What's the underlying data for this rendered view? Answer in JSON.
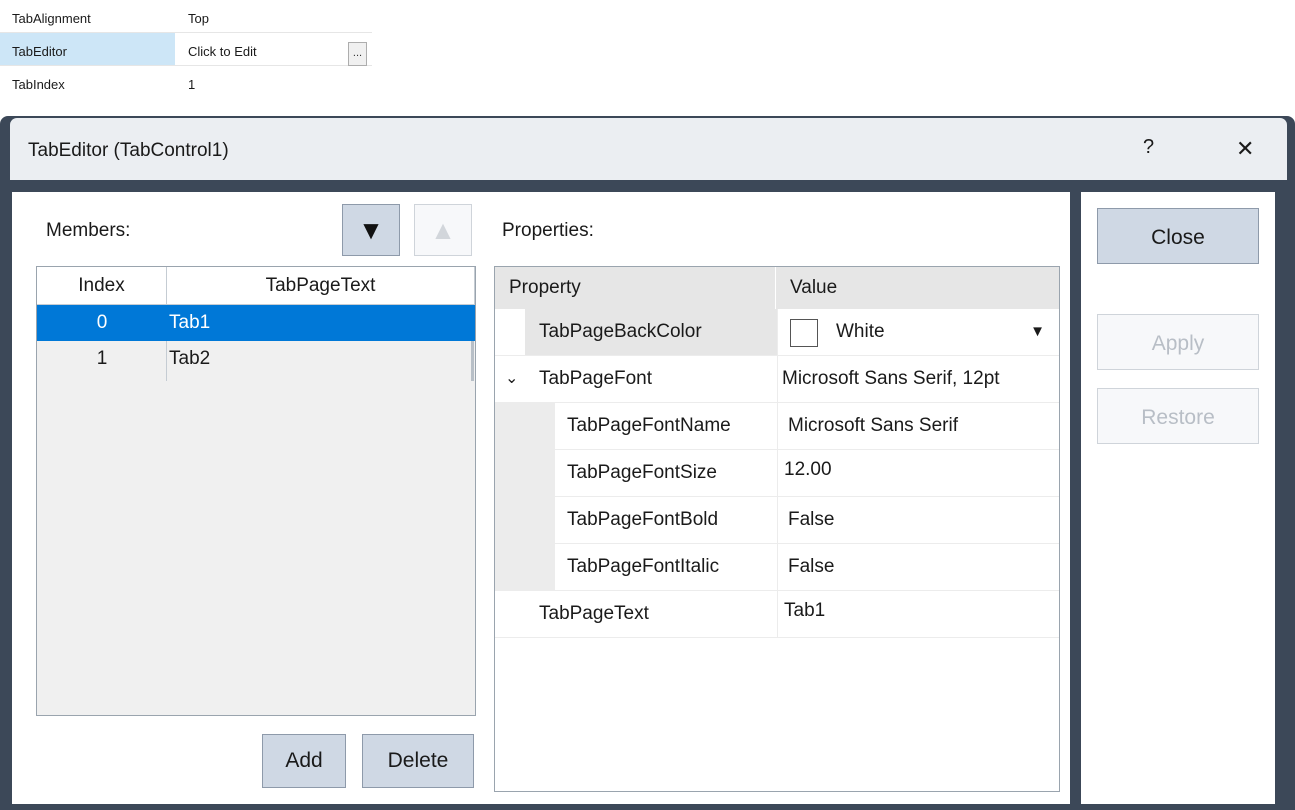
{
  "top_grid": {
    "rows": [
      {
        "name": "TabAlignment",
        "value": "Top"
      },
      {
        "name": "TabEditor",
        "value": "Click to Edit"
      },
      {
        "name": "TabIndex",
        "value": "1"
      }
    ],
    "ellipsis_label": "..."
  },
  "dialog": {
    "title": "TabEditor (TabControl1)",
    "help_label": "?",
    "close_glyph": "✕"
  },
  "members": {
    "label": "Members:",
    "move_down_glyph": "▼",
    "move_up_glyph": "▲",
    "columns": [
      "Index",
      "TabPageText"
    ],
    "rows": [
      {
        "index": "0",
        "text": "Tab1"
      },
      {
        "index": "1",
        "text": "Tab2"
      }
    ],
    "selected_index": 0,
    "add_label": "Add",
    "delete_label": "Delete"
  },
  "properties": {
    "label": "Properties:",
    "columns": [
      "Property",
      "Value"
    ],
    "rows": [
      {
        "name": "TabPageBackColor",
        "value": "White"
      },
      {
        "name": "TabPageFont",
        "value": "Microsoft Sans Serif, 12pt"
      },
      {
        "name": "TabPageFontName",
        "value": "Microsoft Sans Serif"
      },
      {
        "name": "TabPageFontSize",
        "value": "12.00"
      },
      {
        "name": "TabPageFontBold",
        "value": "False"
      },
      {
        "name": "TabPageFontItalic",
        "value": "False"
      },
      {
        "name": "TabPageText",
        "value": "Tab1"
      }
    ],
    "expand_glyph": "⌄",
    "dropdown_glyph": "▼"
  },
  "buttons": {
    "close": "Close",
    "apply": "Apply",
    "restore": "Restore"
  },
  "colors": {
    "dialog_frame": "#3c4858",
    "selection": "#0078d7",
    "button_bg": "#cfd8e4"
  }
}
